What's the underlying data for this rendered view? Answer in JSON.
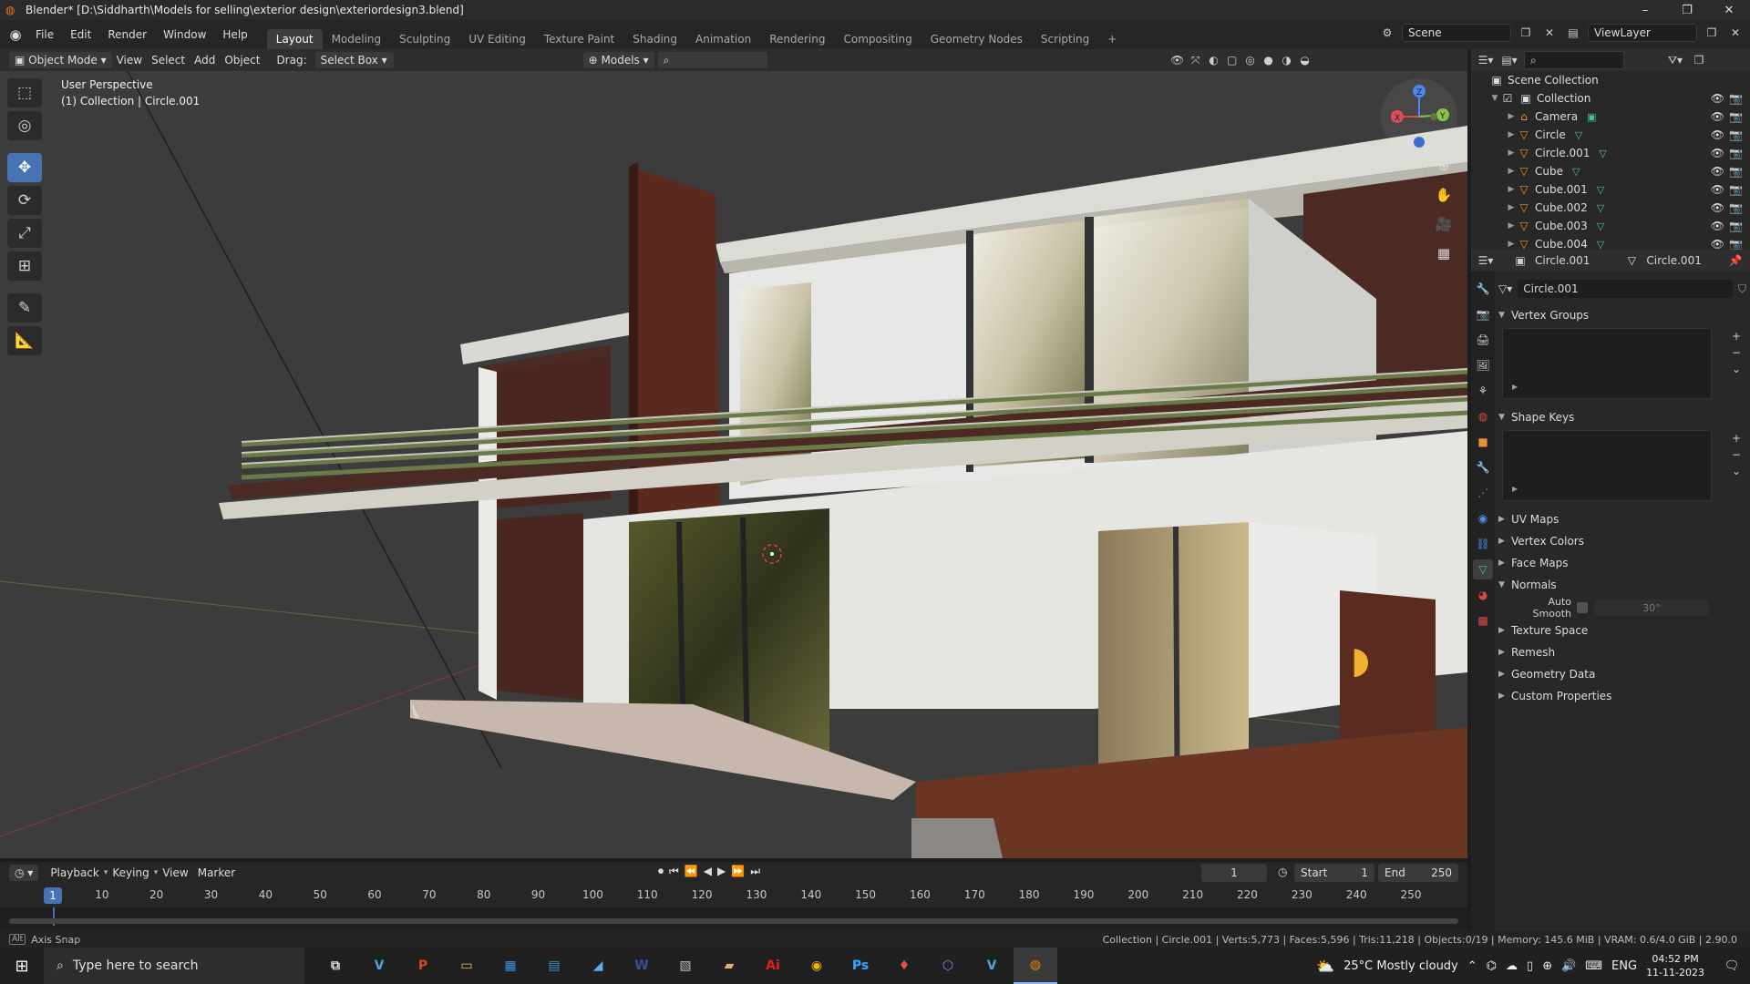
{
  "window": {
    "title": "Blender* [D:\\Siddharth\\Models for selling\\exterior design\\exteriordesign3.blend]",
    "controls": [
      "–",
      "❐",
      "✕"
    ]
  },
  "menu": [
    "File",
    "Edit",
    "Render",
    "Window",
    "Help"
  ],
  "workspaces": [
    "Layout",
    "Modeling",
    "Sculpting",
    "UV Editing",
    "Texture Paint",
    "Shading",
    "Animation",
    "Rendering",
    "Compositing",
    "Geometry Nodes",
    "Scripting"
  ],
  "active_workspace": "Layout",
  "scene": "Scene",
  "view_layer": "ViewLayer",
  "viewport_header": {
    "mode": "Object Mode",
    "menus": [
      "View",
      "Select",
      "Add",
      "Object"
    ],
    "drag_label": "Drag:",
    "drag_value": "Select Box",
    "orientation": "Models"
  },
  "viewport": {
    "perspective": "User Perspective",
    "context": "(1) Collection | Circle.001"
  },
  "outliner": {
    "root": "Scene Collection",
    "collection": "Collection",
    "objects": [
      "Camera",
      "Circle",
      "Circle.001",
      "Cube",
      "Cube.001",
      "Cube.002",
      "Cube.003",
      "Cube.004"
    ]
  },
  "properties": {
    "object_name": "Circle.001",
    "mesh_name": "Circle.001",
    "datablock": "Circle.001",
    "panels_open": [
      "Vertex Groups",
      "Shape Keys"
    ],
    "panels_closed": [
      "UV Maps",
      "Vertex Colors",
      "Face Maps"
    ],
    "normals": "Normals",
    "auto_smooth_label": "Auto Smooth",
    "auto_smooth_angle": "30°",
    "panels_after": [
      "Texture Space",
      "Remesh",
      "Geometry Data",
      "Custom Properties"
    ]
  },
  "timeline": {
    "menus": [
      "Playback",
      "Keying",
      "View",
      "Marker"
    ],
    "current_frame": "1",
    "start_label": "Start",
    "start": "1",
    "end_label": "End",
    "end": "250",
    "ticks": [
      "1",
      "10",
      "20",
      "30",
      "40",
      "50",
      "60",
      "70",
      "80",
      "90",
      "100",
      "110",
      "120",
      "130",
      "140",
      "150",
      "160",
      "170",
      "180",
      "190",
      "200",
      "210",
      "220",
      "230",
      "240",
      "250"
    ]
  },
  "statusbar": {
    "left": "Axis Snap",
    "stats": "Collection | Circle.001 | Verts:5,773 | Faces:5,596 | Tris:11,218 | Objects:0/19 | Memory: 145.6 MiB | VRAM: 0.6/4.0 GiB | 2.90.0"
  },
  "taskbar": {
    "search_placeholder": "Type here to search",
    "weather": "25°C  Mostly cloudy",
    "language": "ENG",
    "time": "04:52 PM",
    "date": "11-11-2023",
    "apps": [
      {
        "name": "V",
        "color": "#4fa3e0"
      },
      {
        "name": "P",
        "color": "#d24726"
      },
      {
        "name": "▭",
        "color": "#f0c24a"
      },
      {
        "name": "▦",
        "color": "#3a96dd"
      },
      {
        "name": "▤",
        "color": "#2f8fd8"
      },
      {
        "name": "◢",
        "color": "#5ab0f0"
      },
      {
        "name": "W",
        "color": "#2b5797"
      },
      {
        "name": "▧",
        "color": "#bbbbbb"
      },
      {
        "name": "▰",
        "color": "#d8b86a"
      },
      {
        "name": "Ai",
        "color": "#e02020"
      },
      {
        "name": "◉",
        "color": "#f4b400"
      },
      {
        "name": "Ps",
        "color": "#31a8ff"
      },
      {
        "name": "♦",
        "color": "#e05050"
      },
      {
        "name": "⬡",
        "color": "#7b83eb"
      },
      {
        "name": "V",
        "color": "#4fa3e0"
      },
      {
        "name": "◍",
        "color": "#e87d0d"
      }
    ]
  },
  "colors": {
    "accent": "#4772b3",
    "mesh_icon": "#e8923b",
    "data_icon": "#47c0a0"
  }
}
